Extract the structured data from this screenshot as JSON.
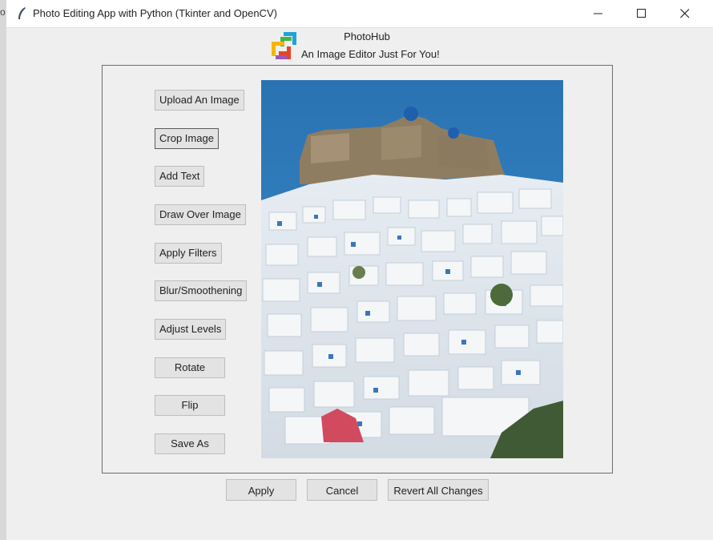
{
  "window": {
    "title": "Photo Editing App with Python (Tkinter and OpenCV)",
    "icon": "feather-icon",
    "controls": [
      "minimize-icon",
      "maximize-icon",
      "close-icon"
    ]
  },
  "header": {
    "app_name": "PhotoHub",
    "tagline": "An Image Editor Just For You!",
    "logo": "photohub-logo"
  },
  "tools": [
    {
      "label": "Upload An Image"
    },
    {
      "label": "Crop Image",
      "focused": true
    },
    {
      "label": "Add Text"
    },
    {
      "label": "Draw Over Image"
    },
    {
      "label": "Apply Filters"
    },
    {
      "label": "Blur/Smoothening"
    },
    {
      "label": "Adjust Levels"
    },
    {
      "label": "Rotate"
    },
    {
      "label": "Flip"
    },
    {
      "label": "Save As"
    }
  ],
  "actions": {
    "apply": "Apply",
    "cancel": "Cancel",
    "revert": "Revert All Changes"
  },
  "left_strip_glyph": "o",
  "colors": {
    "button_bg": "#e3e3e3",
    "window_bg": "#efefef",
    "sea": "#2f78b6"
  }
}
